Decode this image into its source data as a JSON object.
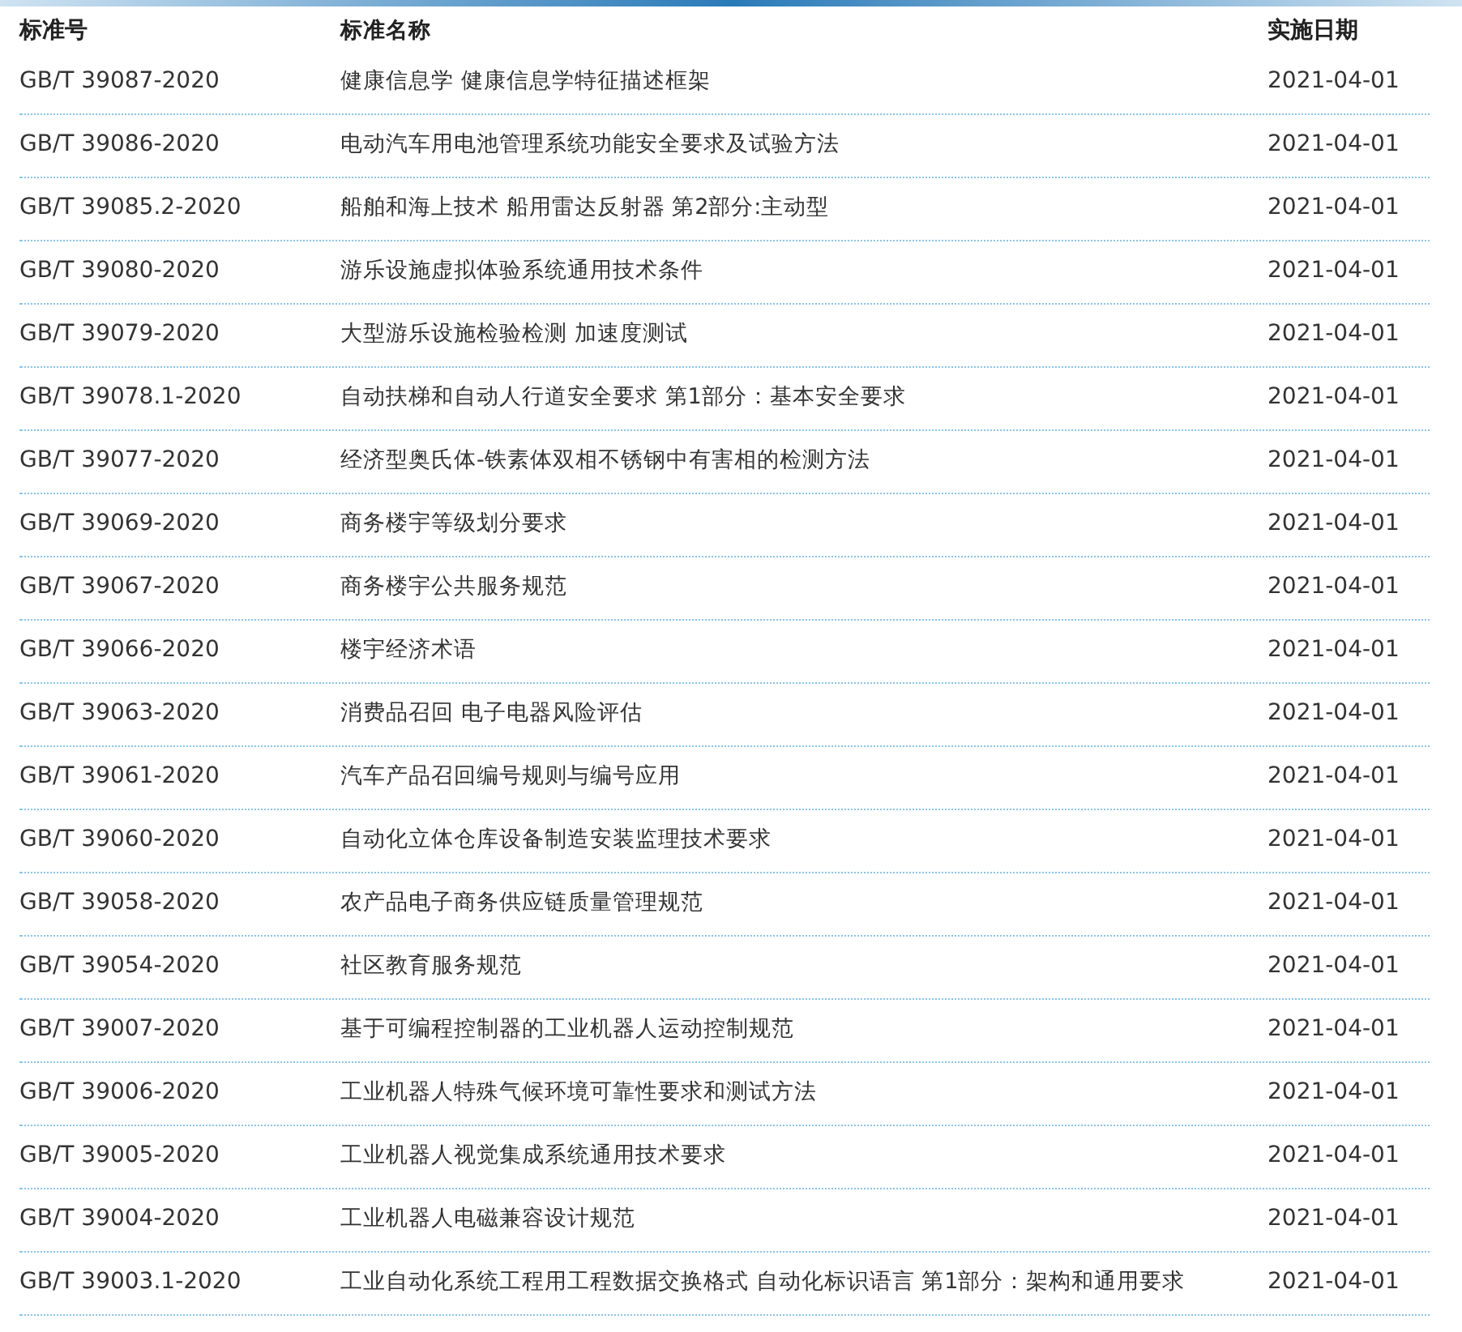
{
  "table": {
    "columns": [
      "标准号",
      "标准名称",
      "实施日期"
    ],
    "rows": [
      {
        "code": "GB/T 39087-2020",
        "name": "健康信息学 健康信息学特征描述框架",
        "date": "2021-04-01"
      },
      {
        "code": "GB/T 39086-2020",
        "name": "电动汽车用电池管理系统功能安全要求及试验方法",
        "date": "2021-04-01"
      },
      {
        "code": "GB/T 39085.2-2020",
        "name": "船舶和海上技术 船用雷达反射器 第2部分:主动型",
        "date": "2021-04-01"
      },
      {
        "code": "GB/T 39080-2020",
        "name": "游乐设施虚拟体验系统通用技术条件",
        "date": "2021-04-01"
      },
      {
        "code": "GB/T 39079-2020",
        "name": "大型游乐设施检验检测 加速度测试",
        "date": "2021-04-01"
      },
      {
        "code": "GB/T 39078.1-2020",
        "name": "自动扶梯和自动人行道安全要求 第1部分：基本安全要求",
        "date": "2021-04-01"
      },
      {
        "code": "GB/T 39077-2020",
        "name": "经济型奥氏体-铁素体双相不锈钢中有害相的检测方法",
        "date": "2021-04-01"
      },
      {
        "code": "GB/T 39069-2020",
        "name": "商务楼宇等级划分要求",
        "date": "2021-04-01"
      },
      {
        "code": "GB/T 39067-2020",
        "name": "商务楼宇公共服务规范",
        "date": "2021-04-01"
      },
      {
        "code": "GB/T 39066-2020",
        "name": "楼宇经济术语",
        "date": "2021-04-01"
      },
      {
        "code": "GB/T 39063-2020",
        "name": "消费品召回 电子电器风险评估",
        "date": "2021-04-01"
      },
      {
        "code": "GB/T 39061-2020",
        "name": "汽车产品召回编号规则与编号应用",
        "date": "2021-04-01"
      },
      {
        "code": "GB/T 39060-2020",
        "name": "自动化立体仓库设备制造安装监理技术要求",
        "date": "2021-04-01"
      },
      {
        "code": "GB/T 39058-2020",
        "name": "农产品电子商务供应链质量管理规范",
        "date": "2021-04-01"
      },
      {
        "code": "GB/T 39054-2020",
        "name": "社区教育服务规范",
        "date": "2021-04-01"
      },
      {
        "code": "GB/T 39007-2020",
        "name": "基于可编程控制器的工业机器人运动控制规范",
        "date": "2021-04-01"
      },
      {
        "code": "GB/T 39006-2020",
        "name": "工业机器人特殊气候环境可靠性要求和测试方法",
        "date": "2021-04-01"
      },
      {
        "code": "GB/T 39005-2020",
        "name": "工业机器人视觉集成系统通用技术要求",
        "date": "2021-04-01"
      },
      {
        "code": "GB/T 39004-2020",
        "name": "工业机器人电磁兼容设计规范",
        "date": "2021-04-01"
      },
      {
        "code": "GB/T 39003.1-2020",
        "name": "工业自动化系统工程用工程数据交换格式 自动化标识语言 第1部分：架构和通用要求",
        "date": "2021-04-01"
      }
    ]
  }
}
